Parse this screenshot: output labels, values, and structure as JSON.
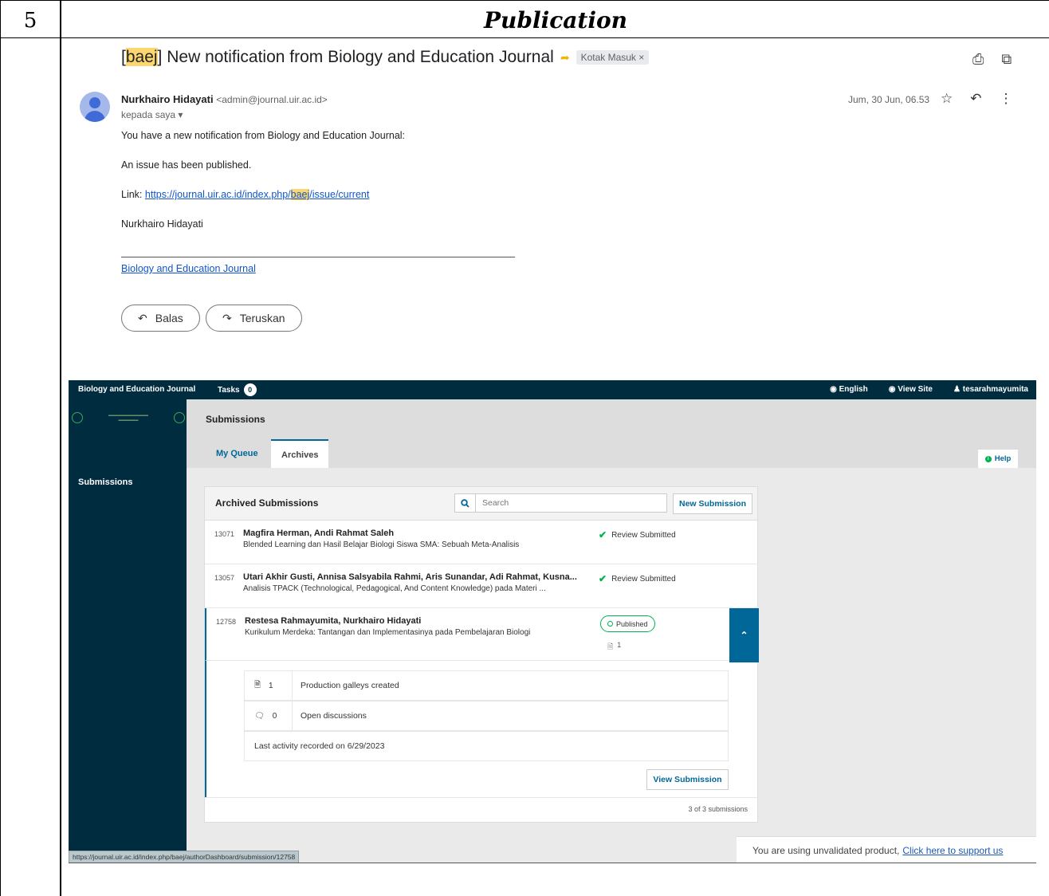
{
  "table": {
    "row_number": "5",
    "row_title": "Publication"
  },
  "mail": {
    "subject_tag": "baej",
    "subject_rest": "New notification from Biology and Education Journal",
    "label": "Kotak Masuk",
    "sender_name": "Nurkhairo Hidayati",
    "sender_email": "<admin@journal.uir.ac.id>",
    "to_me": "kepada saya",
    "date": "Jum, 30 Jun, 06.53",
    "line1": "You have a new notification from Biology and Education Journal:",
    "line2": "An issue has been published.",
    "link_prefix": "Link: ",
    "link_part1": "https://journal.uir.ac.id/index.php/",
    "link_part2": "baej",
    "link_part3": "/issue/current",
    "signature": "Nurkhairo Hidayati",
    "footer_link": "Biology and Education Journal",
    "reply_label": "Balas",
    "forward_label": "Teruskan"
  },
  "ojs": {
    "brand": "Biology and Education Journal",
    "tasks_label": "Tasks",
    "tasks_count": "0",
    "lang": "English",
    "view_site": "View Site",
    "user": "tesarahmayumita",
    "sidebar_item": "Submissions",
    "page_title": "Submissions",
    "tabs": [
      "My Queue",
      "Archives"
    ],
    "help": "Help",
    "panel_title": "Archived Submissions",
    "search_placeholder": "Search",
    "new_submission": "New Submission",
    "submissions": [
      {
        "id": "13071",
        "authors": "Magfira Herman, Andi Rahmat Saleh",
        "title": "Blended Learning dan Hasil Belajar Biologi Siswa SMA: Sebuah Meta-Analisis",
        "status": "Review Submitted"
      },
      {
        "id": "13057",
        "authors": "Utari Akhir Gusti, Annisa Salsyabila Rahmi, Aris Sunandar, Adi Rahmat, Kusna...",
        "title": "Analisis TPACK (Technological, Pedagogical, And Content Knowledge) pada Materi ...",
        "status": "Review Submitted"
      },
      {
        "id": "12758",
        "authors": "Restesa Rahmayumita, Nurkhairo Hidayati",
        "title": "Kurikulum Merdeka: Tantangan dan Implementasinya pada Pembelajaran Biologi",
        "status": "Published",
        "galleys": "1"
      }
    ],
    "details": {
      "galleys_count": "1",
      "galleys_label": "Production galleys created",
      "discussions_count": "0",
      "discussions_label": "Open discussions",
      "last_activity": "Last activity recorded on 6/29/2023",
      "view_submission": "View Submission"
    },
    "count_text": "3 of 3 submissions",
    "status_url": "https://journal.uir.ac.id/index.php/baej/authorDashboard/submission/12758",
    "unvalidated_text": "You are using unvalidated product,",
    "unvalidated_link": "Click here to support us"
  }
}
